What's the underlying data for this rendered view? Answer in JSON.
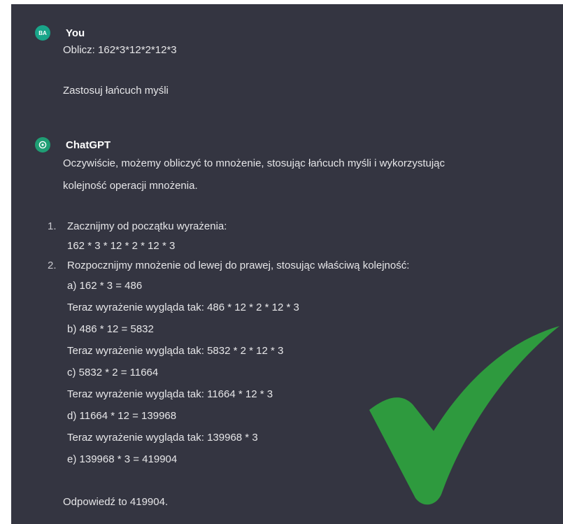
{
  "user": {
    "avatar_initials": "BA",
    "name": "You",
    "lines": [
      "Oblicz: 162*3*12*2*12*3",
      "Zastosuj łańcuch myśli"
    ]
  },
  "assistant": {
    "name": "ChatGPT",
    "intro_lines": [
      "Oczywiście, możemy obliczyć to mnożenie, stosując łańcuch myśli i wykorzystując",
      "kolejność operacji mnożenia."
    ],
    "steps": [
      {
        "number": "1.",
        "text": "Zacznijmy od początku wyrażenia:",
        "details": [
          "162 * 3 * 12 * 2 * 12 * 3"
        ]
      },
      {
        "number": "2.",
        "text": "Rozpocznijmy mnożenie od lewej do prawej, stosując właściwą kolejność:",
        "details": [
          "a) 162 * 3 = 486",
          "Teraz wyrażenie wygląda tak: 486 * 12 * 2 * 12 * 3",
          "b) 486 * 12 = 5832",
          "Teraz wyrażenie wygląda tak: 5832 * 2 * 12 * 3",
          "c) 5832 * 2 = 11664",
          "Teraz wyrażenie wygląda tak: 11664 * 12 * 3",
          "d) 11664 * 12 = 139968",
          "Teraz wyrażenie wygląda tak: 139968 * 3",
          "e) 139968 * 3 = 419904"
        ]
      }
    ],
    "answer": "Odpowiedź to 419904."
  },
  "overlay": {
    "icon": "check-mark-icon",
    "color": "#2e9a3e"
  },
  "colors": {
    "background": "#343541",
    "text": "#e6e6e8",
    "user_avatar": "#19a589",
    "assistant_avatar": "#1f9e74"
  }
}
